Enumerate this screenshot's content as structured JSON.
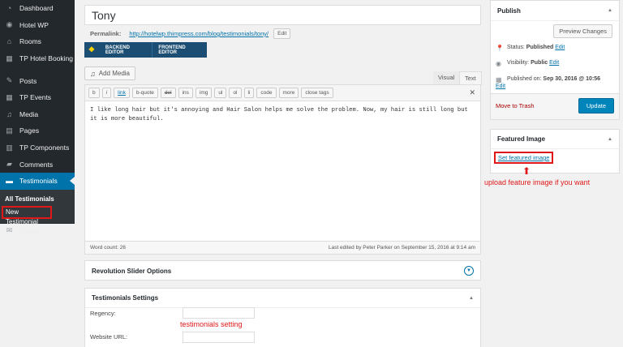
{
  "sidebar": {
    "items": [
      {
        "label": "Dashboard",
        "icon": "dashboard-icon"
      },
      {
        "label": "Hotel WP",
        "icon": "hotel-icon"
      },
      {
        "label": "Rooms",
        "icon": "home-icon"
      },
      {
        "label": "TP Hotel Booking",
        "icon": "calendar-icon"
      },
      {
        "label": "Posts",
        "icon": "pin-icon"
      },
      {
        "label": "TP Events",
        "icon": "calendar-icon"
      },
      {
        "label": "Media",
        "icon": "media-icon"
      },
      {
        "label": "Pages",
        "icon": "page-icon"
      },
      {
        "label": "TP Components",
        "icon": "grid-icon"
      },
      {
        "label": "Comments",
        "icon": "comment-icon"
      },
      {
        "label": "Testimonials",
        "icon": "testimonial-icon"
      }
    ],
    "submenu": [
      "All Testimonials",
      "New Testimonial"
    ],
    "after": {
      "label": "Contact",
      "icon": "mail-icon"
    }
  },
  "editor": {
    "title_value": "Tony",
    "permalink_label": "Permalink:",
    "permalink_url": "http://hotelwp.thimpress.com/blog/testimonials/tony/",
    "permalink_edit": "Edit",
    "backend_editor": "BACKEND EDITOR",
    "frontend_editor": "FRONTEND EDITOR",
    "add_media": "Add Media",
    "tab_visual": "Visual",
    "tab_text": "Text",
    "quicktags": [
      "b",
      "i",
      "link",
      "b-quote",
      "del",
      "ins",
      "img",
      "ul",
      "ol",
      "li",
      "code",
      "more",
      "close tags"
    ],
    "content": "I like long hair but it's annoying and Hair Salon helps me solve the problem. Now, my hair is still long but it is more beautiful.",
    "word_count": "Word count: 26",
    "last_edited": "Last edited by Peter Parker on September 15, 2016 at 9:14 am"
  },
  "revolution": {
    "title": "Revolution Slider Options"
  },
  "testimonial_settings": {
    "title": "Testimonials Settings",
    "regency_label": "Regency:",
    "website_label": "Website URL:",
    "annotation": "testimonials setting"
  },
  "publish": {
    "title": "Publish",
    "preview_button": "Preview Changes",
    "status_label": "Status:",
    "status_value": "Published",
    "visibility_label": "Visibility:",
    "visibility_value": "Public",
    "published_label": "Published on:",
    "published_value": "Sep 30, 2016 @ 10:56",
    "edit": "Edit",
    "trash": "Move to Trash",
    "update": "Update"
  },
  "featured": {
    "title": "Featured Image",
    "link": "Set featured image",
    "annotation": "upload feature image if you want"
  },
  "colors": {
    "accent": "#0073aa",
    "annotation": "#e0181a",
    "sidebar": "#23282d"
  }
}
